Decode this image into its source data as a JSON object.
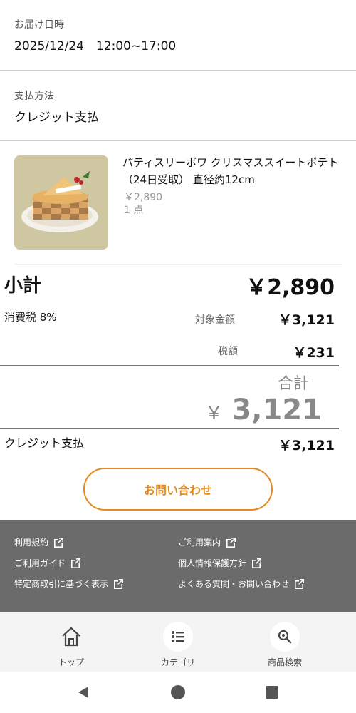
{
  "delivery": {
    "label": "お届け日時",
    "value": "2025/12/24　12:00~17:00"
  },
  "payment": {
    "label": "支払方法",
    "value": "クレジット支払"
  },
  "product": {
    "name": "パティスリーボワ クリスマススイートポテト（24日受取） 直径約12cm",
    "price": "￥2,890",
    "quantity": "1 点",
    "image_icon": "cake-photo"
  },
  "summary": {
    "subtotal_label": "小計",
    "subtotal_value": "￥2,890",
    "tax_label": "消費税 8%",
    "taxable_label": "対象金額",
    "taxable_value": "￥3,121",
    "tax_amount_label": "税額",
    "tax_amount_value": "￥231",
    "total_label": "合計",
    "total_currency": "￥",
    "total_value": "3,121",
    "payment_label": "クレジット支払",
    "payment_value": "￥3,121"
  },
  "contact_button": "お問い合わせ",
  "accent_color": "#e58a1c",
  "footer_links": [
    {
      "label": "利用規約"
    },
    {
      "label": "ご利用案内"
    },
    {
      "label": "ご利用ガイド"
    },
    {
      "label": "個人情報保護方針"
    },
    {
      "label": "特定商取引に基づく表示"
    },
    {
      "label": "よくある質問・お問い合わせ"
    }
  ],
  "tabs": [
    {
      "label": "トップ",
      "icon": "home-icon"
    },
    {
      "label": "カテゴリ",
      "icon": "list-icon"
    },
    {
      "label": "商品検索",
      "icon": "search-icon"
    }
  ]
}
